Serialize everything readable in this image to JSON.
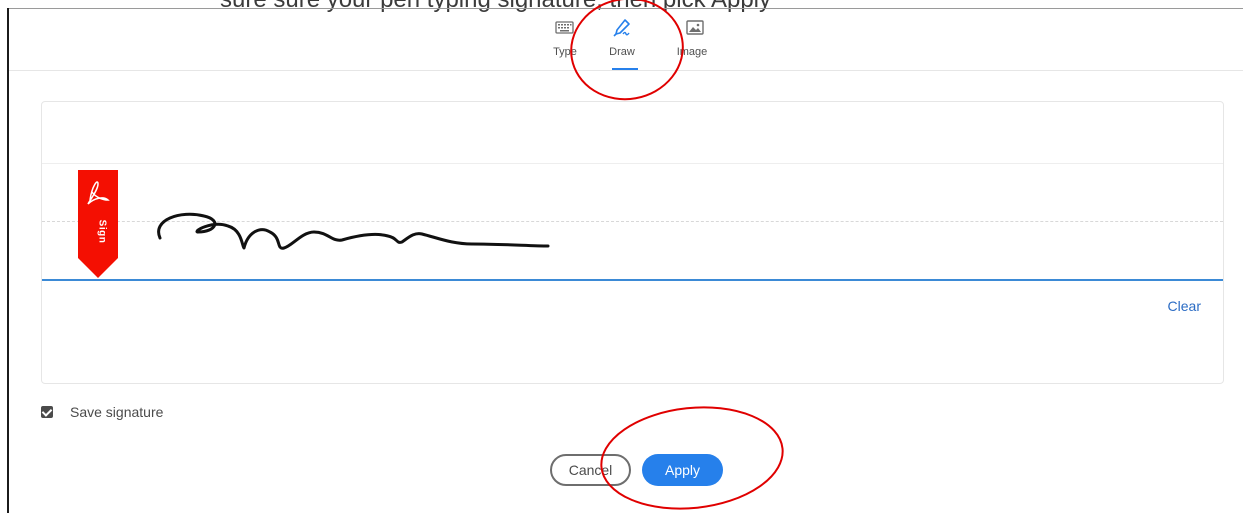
{
  "background_text": {
    "visible": "sure sure your pen typing signature, then pick Apply"
  },
  "tabs": [
    {
      "label": "Type",
      "icon": "keyboard-icon",
      "active": false
    },
    {
      "label": "Draw",
      "icon": "pen-icon",
      "active": true
    },
    {
      "label": "Image",
      "icon": "image-icon",
      "active": false
    }
  ],
  "panel": {
    "clear_label": "Clear",
    "sign_tag_text": "Sign"
  },
  "save_signature": {
    "label": "Save signature",
    "checked": true
  },
  "buttons": {
    "cancel": "Cancel",
    "apply": "Apply"
  },
  "colors": {
    "accent": "#2680eb",
    "annotation": "#e00000",
    "sign_tag": "#f40f02"
  }
}
